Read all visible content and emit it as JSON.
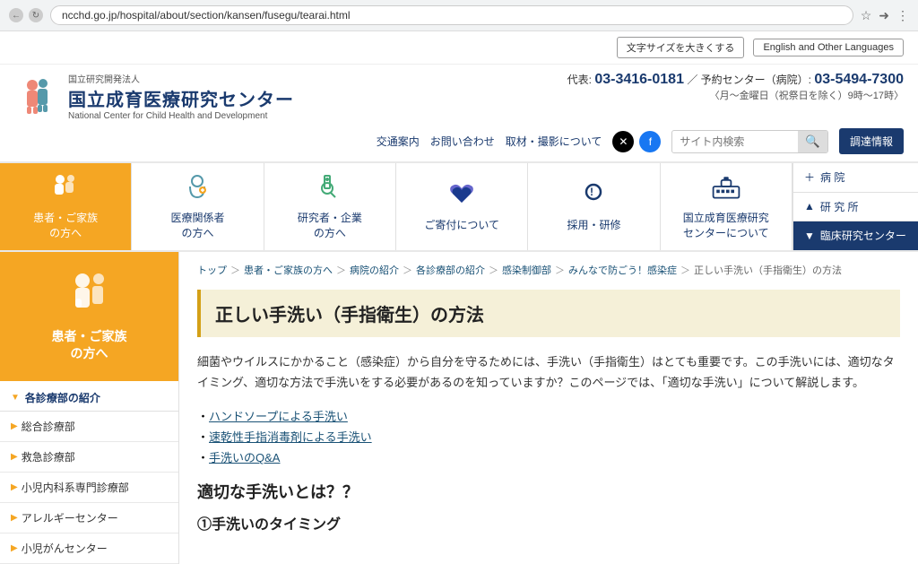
{
  "browser": {
    "url": "ncchd.go.jp/hospital/about/section/kansen/fusegu/tearai.html"
  },
  "utility": {
    "font_size_label": "文字サイズを大きくする",
    "lang_label": "English and Other Languages"
  },
  "header": {
    "org_small": "国立研究開発法人",
    "org_main": "国立成育医療研究センター",
    "org_english": "National Center for Child Health and Development",
    "phone_label": "代表:",
    "phone_number": "03-3416-0181",
    "separator": "／",
    "reservation_label": "予約センター（病院）:",
    "reservation_number": "03-5494-7300",
    "hours": "〈月〜金曜日（祝祭日を除く）9時〜17時〉"
  },
  "search_row": {
    "access": "交通案内",
    "inquiry": "お問い合わせ",
    "media": "取材・撮影について",
    "search_placeholder": "サイト内検索",
    "info_btn": "調達情報"
  },
  "main_nav": {
    "items": [
      {
        "icon": "👨‍👩‍👧",
        "text": "患者・ご家族\nの方へ",
        "active": true
      },
      {
        "icon": "🩺",
        "text": "医療関係者\nの方へ",
        "active": false
      },
      {
        "icon": "🔬",
        "text": "研究者・企業\nの方へ",
        "active": false
      },
      {
        "icon": "💙",
        "text": "ご寄付について",
        "active": false
      },
      {
        "icon": "❕",
        "text": "採用・研修",
        "active": false
      },
      {
        "icon": "🏥",
        "text": "国立成育医療研究\nセンターについて",
        "active": false
      }
    ],
    "right_items": [
      {
        "icon": "+",
        "text": "病 院",
        "style": "normal"
      },
      {
        "icon": "▲",
        "text": "研 究 所",
        "style": "normal"
      },
      {
        "icon": "▼",
        "text": "臨床研究センター",
        "style": "blue"
      }
    ]
  },
  "sidebar": {
    "hero_text_line1": "患者・ご家族",
    "hero_text_line2": "の方へ",
    "section_title": "各診療部の紹介",
    "items": [
      "総合診療部",
      "救急診療部",
      "小児内科系専門診療部",
      "アレルギーセンター",
      "小児がんセンター"
    ]
  },
  "breadcrumb": {
    "items": [
      {
        "label": "トップ",
        "link": true
      },
      {
        "label": "患者・ご家族の方へ",
        "link": true
      },
      {
        "label": "病院の紹介",
        "link": true
      },
      {
        "label": "各診療部の紹介",
        "link": true
      },
      {
        "label": "感染制御部",
        "link": true
      },
      {
        "label": "みんなで防ごう！感染症",
        "link": true
      },
      {
        "label": "正しい手洗い（手指衛生）の方法",
        "link": false
      }
    ]
  },
  "article": {
    "title": "正しい手洗い（手指衛生）の方法",
    "body": "細菌やウイルスにかかること（感染症）から自分を守るためには、手洗い（手指衛生）はとても重要です。この手洗いには、適切なタイミング、適切な方法で手洗いをする必要があるのを知っていますか？このページでは、「適切な手洗い」について解説します。",
    "links": [
      "ハンドソープによる手洗い",
      "速乾性手指消毒剤による手洗い",
      "手洗いのQ&A"
    ],
    "section1_title": "適切な手洗いとは？？",
    "section2_title": "①手洗いのタイミング"
  }
}
